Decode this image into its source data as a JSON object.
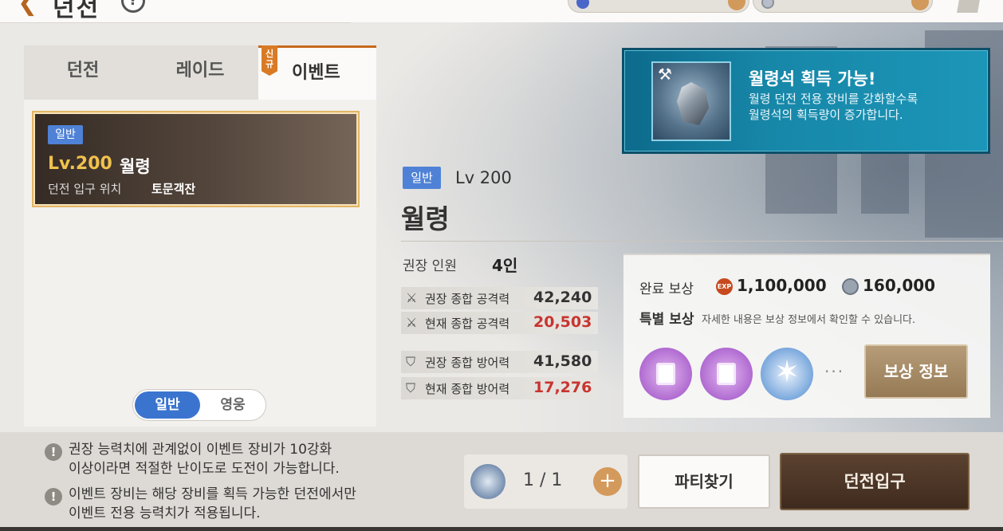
{
  "header": {
    "title": "던전"
  },
  "tabs": [
    {
      "label": "던전"
    },
    {
      "label": "레이드"
    },
    {
      "label": "이벤트",
      "badge": "신규"
    }
  ],
  "dungeon_card": {
    "grade": "일반",
    "level": "Lv.200",
    "name": "월령",
    "location_label": "던전 입구 위치",
    "location_value": "토문객잔"
  },
  "mode_toggle": {
    "normal": "일반",
    "hero": "영웅",
    "selected": "일반"
  },
  "detail": {
    "grade": "일반",
    "level": "Lv 200",
    "name": "월령",
    "party_label": "권장 인원",
    "party_value": "4인",
    "stats": [
      {
        "icon": "crossed-swords-icon",
        "label": "권장 종합 공격력",
        "value": "42,240"
      },
      {
        "icon": "crossed-swords-icon",
        "label": "현재 종합 공격력",
        "value": "20,503",
        "status_color": "#c8342f"
      },
      {
        "icon": "shield-icon",
        "label": "권장 종합 방어력",
        "value": "41,580"
      },
      {
        "icon": "shield-icon",
        "label": "현재 종합 방어력",
        "value": "17,276",
        "status_color": "#c8342f"
      }
    ]
  },
  "banner": {
    "title": "월령석 획득 가능!",
    "desc_line1": "월령 던전 전용 장비를 강화할수록",
    "desc_line2": "월령석의 획득량이 증가합니다."
  },
  "rewards": {
    "complete_label": "완료 보상",
    "exp_icon_text": "EXP",
    "exp_value": "1,100,000",
    "silver_value": "160,000",
    "special_label": "특별 보상",
    "special_desc": "자세한 내용은 보상 정보에서 확인할 수 있습니다.",
    "items": [
      "scroll-icon",
      "scroll-icon",
      "star-emblem-icon"
    ],
    "more": "···",
    "info_button": "보상 정보"
  },
  "notices": [
    {
      "line1": "권장 능력치에 관계없이 이벤트 장비가 10강화",
      "line2": "이상이라면 적절한 난이도로 도전이 가능합니다."
    },
    {
      "line1": "이벤트 장비는 해당 장비를 획득 가능한 던전에서만",
      "line2": "이벤트 전용 능력치가 적용됩니다."
    }
  ],
  "ticket": {
    "count": "1 / 1",
    "plus": "+"
  },
  "buttons": {
    "party_find": "파티찾기",
    "enter": "던전입구"
  },
  "colors": {
    "accent_orange": "#c76a1c",
    "grade_blue": "#4f82d6",
    "warning_red": "#c8342f",
    "enter_brown": "#4a3424"
  }
}
